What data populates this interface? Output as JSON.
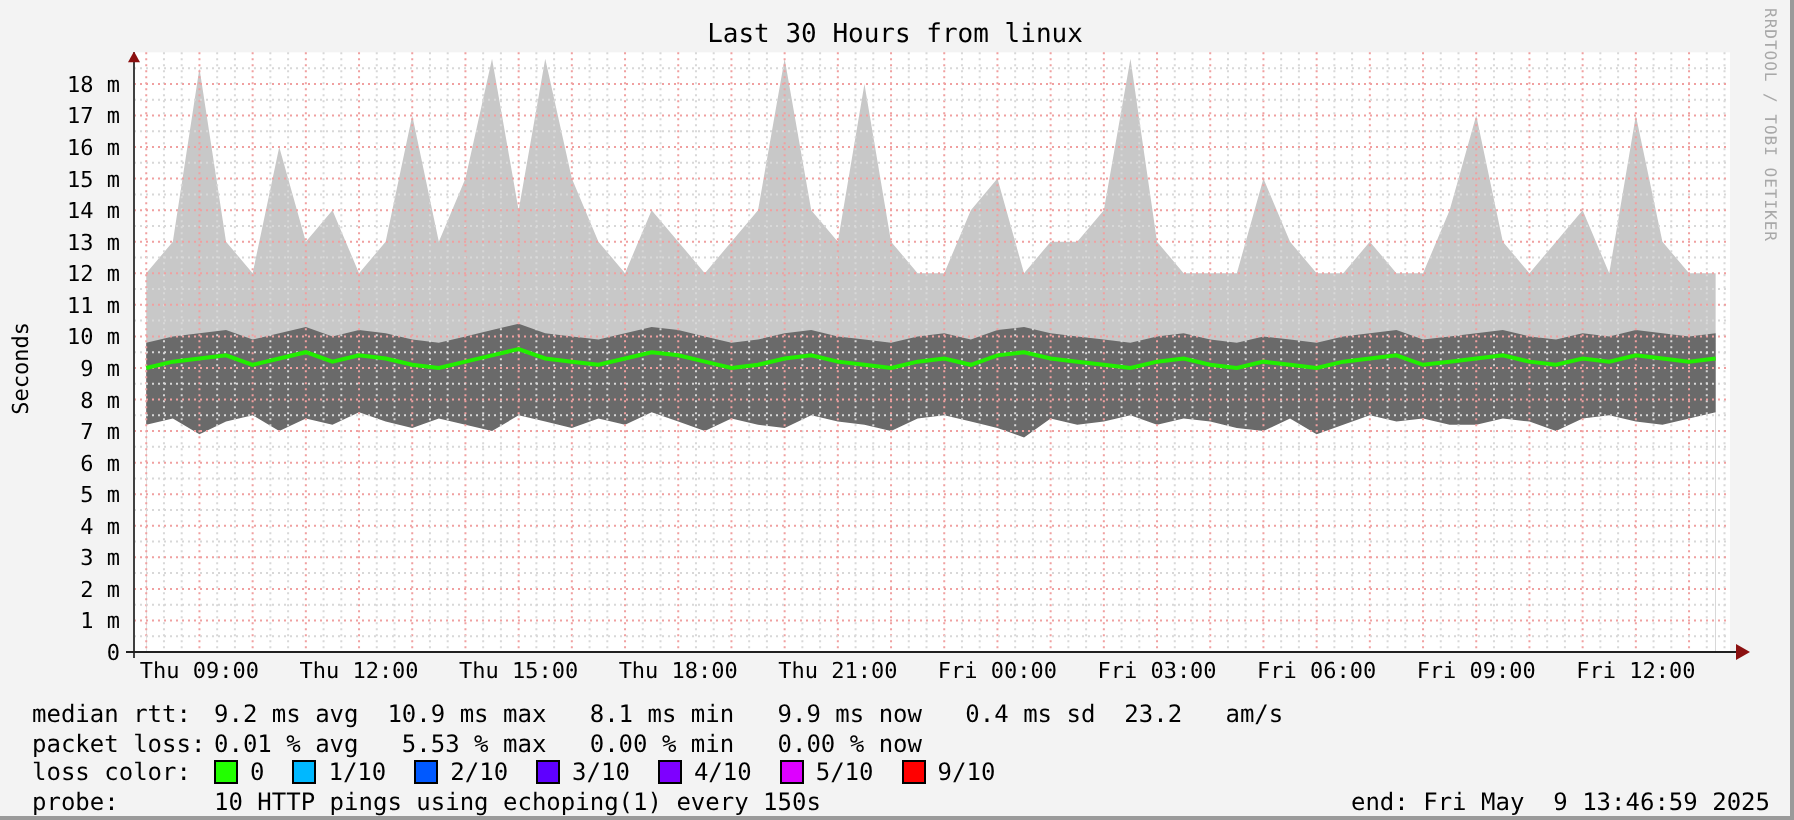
{
  "graph": {
    "title": "Last 30 Hours from linux",
    "credit": "RRDTOOL / TOBI OETIKER",
    "chart_data": {
      "type": "area",
      "grid": true,
      "ylabel": "Seconds",
      "ylim": [
        0,
        19
      ],
      "categories": [
        null,
        null,
        "Thu 09:00",
        null,
        null,
        null,
        null,
        null,
        "Thu 12:00",
        null,
        null,
        null,
        null,
        null,
        "Thu 15:00",
        null,
        null,
        null,
        null,
        null,
        "Thu 18:00",
        null,
        null,
        null,
        null,
        null,
        "Thu 21:00",
        null,
        null,
        null,
        null,
        null,
        "Fri 00:00",
        null,
        null,
        null,
        null,
        null,
        "Fri 03:00",
        null,
        null,
        null,
        null,
        null,
        "Fri 06:00",
        null,
        null,
        null,
        null,
        null,
        "Fri 09:00",
        null,
        null,
        null,
        null,
        null,
        "Fri 12:00",
        null,
        null,
        null
      ],
      "yticks": [
        {
          "value": 0,
          "label": "0"
        },
        {
          "value": 1,
          "label": "1 m"
        },
        {
          "value": 2,
          "label": "2 m"
        },
        {
          "value": 3,
          "label": "3 m"
        },
        {
          "value": 4,
          "label": "4 m"
        },
        {
          "value": 5,
          "label": "5 m"
        },
        {
          "value": 6,
          "label": "6 m"
        },
        {
          "value": 7,
          "label": "7 m"
        },
        {
          "value": 8,
          "label": "8 m"
        },
        {
          "value": 9,
          "label": "9 m"
        },
        {
          "value": 10,
          "label": "10 m"
        },
        {
          "value": 11,
          "label": "11 m"
        },
        {
          "value": 12,
          "label": "12 m"
        },
        {
          "value": 13,
          "label": "13 m"
        },
        {
          "value": 14,
          "label": "14 m"
        },
        {
          "value": 15,
          "label": "15 m"
        },
        {
          "value": 16,
          "label": "16 m"
        },
        {
          "value": 17,
          "label": "17 m"
        },
        {
          "value": 18,
          "label": "18 m"
        }
      ],
      "series": [
        {
          "color": "#c8c8c8",
          "values": [
            12,
            13,
            18.5,
            13,
            12,
            16,
            13,
            14,
            12,
            13,
            17,
            13,
            15,
            18.8,
            14,
            18.8,
            15,
            13,
            12,
            14,
            13,
            12,
            13,
            14,
            18.8,
            14,
            13,
            18,
            13,
            12,
            12,
            14,
            15,
            12,
            13,
            13,
            14,
            18.8,
            13,
            12,
            12,
            12,
            15,
            13,
            12,
            12,
            13,
            12,
            12,
            14,
            17,
            13,
            12,
            13,
            14,
            12,
            17,
            13,
            12,
            12
          ]
        },
        {
          "color": "#6a6a6a",
          "values": [
            9.8,
            10.0,
            10.1,
            10.2,
            9.9,
            10.1,
            10.3,
            10.0,
            10.2,
            10.1,
            9.9,
            9.8,
            10.0,
            10.2,
            10.4,
            10.1,
            10.0,
            9.9,
            10.1,
            10.3,
            10.2,
            10.0,
            9.8,
            9.9,
            10.1,
            10.2,
            10.0,
            9.9,
            9.8,
            10.0,
            10.1,
            9.9,
            10.2,
            10.3,
            10.1,
            10.0,
            9.9,
            9.8,
            10.0,
            10.1,
            9.9,
            9.8,
            10.0,
            9.9,
            9.8,
            10.0,
            10.1,
            10.2,
            9.9,
            10.0,
            10.1,
            10.2,
            10.0,
            9.9,
            10.1,
            10.0,
            10.2,
            10.1,
            10.0,
            10.1
          ]
        },
        {
          "color": "#ffffff",
          "values": [
            7.2,
            7.4,
            6.9,
            7.3,
            7.5,
            7.0,
            7.4,
            7.2,
            7.6,
            7.3,
            7.1,
            7.4,
            7.2,
            7.0,
            7.5,
            7.3,
            7.1,
            7.4,
            7.2,
            7.6,
            7.3,
            7.0,
            7.4,
            7.2,
            7.1,
            7.5,
            7.3,
            7.2,
            7.0,
            7.4,
            7.5,
            7.3,
            7.1,
            6.8,
            7.4,
            7.2,
            7.3,
            7.5,
            7.2,
            7.4,
            7.3,
            7.1,
            7.0,
            7.4,
            6.9,
            7.2,
            7.5,
            7.3,
            7.4,
            7.2,
            7.2,
            7.4,
            7.3,
            7.0,
            7.4,
            7.5,
            7.3,
            7.2,
            7.4,
            7.6
          ]
        },
        {
          "type": "line",
          "color": "#22ee00",
          "values": [
            9.0,
            9.2,
            9.3,
            9.4,
            9.1,
            9.3,
            9.5,
            9.2,
            9.4,
            9.3,
            9.1,
            9.0,
            9.2,
            9.4,
            9.6,
            9.3,
            9.2,
            9.1,
            9.3,
            9.5,
            9.4,
            9.2,
            9.0,
            9.1,
            9.3,
            9.4,
            9.2,
            9.1,
            9.0,
            9.2,
            9.3,
            9.1,
            9.4,
            9.5,
            9.3,
            9.2,
            9.1,
            9.0,
            9.2,
            9.3,
            9.1,
            9.0,
            9.2,
            9.1,
            9.0,
            9.2,
            9.3,
            9.4,
            9.1,
            9.2,
            9.3,
            9.4,
            9.2,
            9.1,
            9.3,
            9.2,
            9.4,
            9.3,
            9.2,
            9.3
          ]
        }
      ]
    }
  },
  "legend": {
    "rows": [
      {
        "label": "median rtt:",
        "text": "9.2 ms avg  10.9 ms max   8.1 ms min   9.9 ms now   0.4 ms sd  23.2   am/s"
      },
      {
        "label": "packet loss:",
        "text": "0.01 % avg   5.53 % max   0.00 % min   0.00 % now"
      }
    ],
    "loss_color": {
      "label": "loss color:",
      "items": [
        {
          "label": "0",
          "color": "#22ff00"
        },
        {
          "label": "1/10",
          "color": "#00b8ff"
        },
        {
          "label": "2/10",
          "color": "#0059ff"
        },
        {
          "label": "3/10",
          "color": "#5e00ff"
        },
        {
          "label": "4/10",
          "color": "#7e00ff"
        },
        {
          "label": "5/10",
          "color": "#dd00ff"
        },
        {
          "label": "9/10",
          "color": "#ff0000"
        }
      ]
    },
    "probe": {
      "label": "probe:",
      "text": "10 HTTP pings using echoping(1) every 150s",
      "end": "end: Fri May  9 13:46:59 2025"
    }
  }
}
